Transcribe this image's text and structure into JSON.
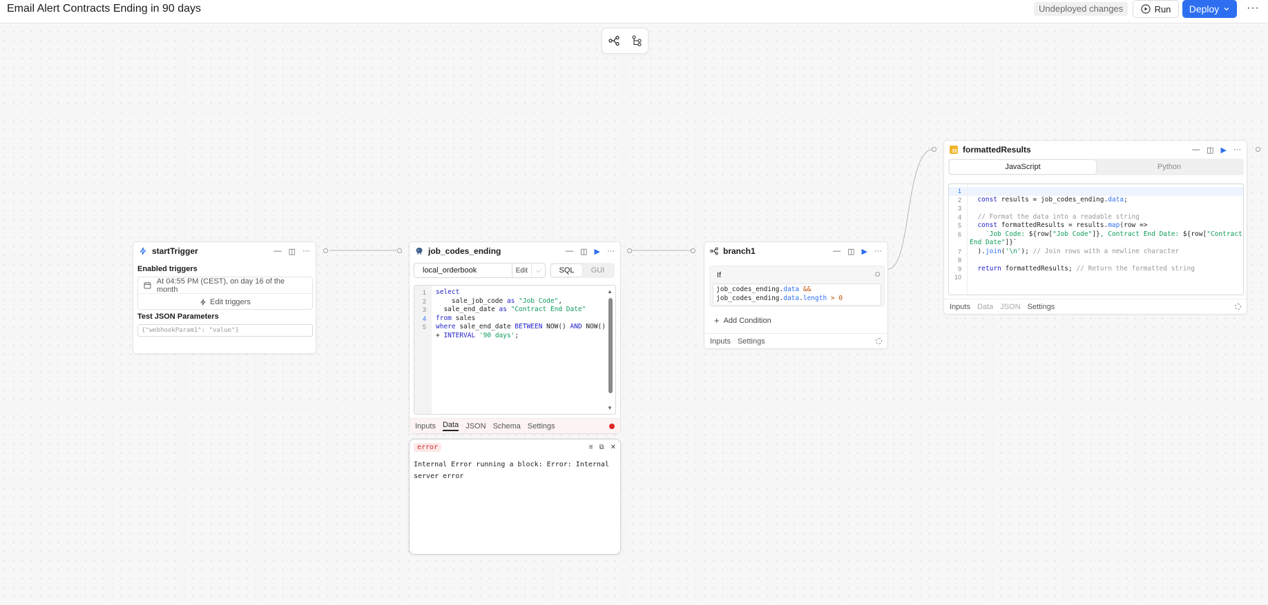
{
  "header": {
    "title": "Email Alert Contracts Ending in 90 days",
    "status_badge": "Undeployed changes",
    "run_label": "Run",
    "deploy_label": "Deploy",
    "more_label": "···"
  },
  "nodes": {
    "start_trigger": {
      "title": "startTrigger",
      "enabled_triggers_label": "Enabled triggers",
      "schedule_text": "At 04:55 PM (CEST), on day 16 of the month",
      "edit_triggers_label": "Edit triggers",
      "test_json_label": "Test JSON Parameters",
      "test_json_placeholder": "{\"webhookParam1\": \"value\"}"
    },
    "job_codes_ending": {
      "title": "job_codes_ending",
      "resource": "local_orderbook",
      "edit_label": "Edit",
      "mode_sql": "SQL",
      "mode_gui": "GUI",
      "line_numbers": [
        "1",
        "2",
        "3",
        "4",
        "5"
      ],
      "tabs": [
        "Inputs",
        "Data",
        "JSON",
        "Schema",
        "Settings"
      ],
      "active_tab": "Data"
    },
    "error_panel": {
      "badge": "error",
      "message": "Internal Error running a block: Error: Internal server error"
    },
    "branch1": {
      "title": "branch1",
      "if_label": "If",
      "add_condition_label": "Add Condition",
      "tabs": [
        "Inputs",
        "Settings"
      ]
    },
    "formatted_results": {
      "title": "formattedResults",
      "lang_js": "JavaScript",
      "lang_python": "Python",
      "line_numbers": [
        "1",
        "2",
        "3",
        "4",
        "5",
        "6",
        "",
        "7",
        "8",
        "9",
        "10"
      ],
      "tabs": [
        "Inputs",
        "Data",
        "JSON",
        "Settings"
      ]
    }
  },
  "code": {
    "sql": [
      [
        {
          "t": "select",
          "c": "kw"
        }
      ],
      [
        {
          "t": "    sale_job_code ",
          "c": ""
        },
        {
          "t": "as",
          "c": "kw"
        },
        {
          "t": " \"Job Code\"",
          "c": "str"
        },
        {
          "t": ",",
          "c": ""
        }
      ],
      [
        {
          "t": "  sale_end_date ",
          "c": ""
        },
        {
          "t": "as",
          "c": "kw"
        },
        {
          "t": " \"Contract End Date\"",
          "c": "str"
        }
      ],
      [
        {
          "t": "from",
          "c": "kw"
        },
        {
          "t": " sales",
          "c": ""
        }
      ],
      [
        {
          "t": "where",
          "c": "kw"
        },
        {
          "t": " sale_end_date ",
          "c": ""
        },
        {
          "t": "BETWEEN",
          "c": "kw"
        },
        {
          "t": " NOW() ",
          "c": ""
        },
        {
          "t": "AND",
          "c": "kw"
        },
        {
          "t": " NOW()",
          "c": ""
        }
      ],
      [
        {
          "t": "+ ",
          "c": ""
        },
        {
          "t": "INTERVAL",
          "c": "kw"
        },
        {
          "t": " '90 days'",
          "c": "str"
        },
        {
          "t": ";",
          "c": ""
        }
      ]
    ],
    "condition": [
      [
        {
          "t": "job_codes_ending.",
          "c": ""
        },
        {
          "t": "data",
          "c": "prop"
        },
        {
          "t": " &&",
          "c": "num"
        }
      ],
      [
        {
          "t": "job_codes_ending.",
          "c": ""
        },
        {
          "t": "data",
          "c": "prop"
        },
        {
          "t": ".",
          "c": ""
        },
        {
          "t": "length",
          "c": "prop"
        },
        {
          "t": " > 0",
          "c": "num"
        }
      ]
    ],
    "js": [
      [
        {
          "t": "",
          "c": ""
        }
      ],
      [
        {
          "t": "  const",
          "c": "kw"
        },
        {
          "t": " results = job_codes_ending.",
          "c": ""
        },
        {
          "t": "data",
          "c": "prop"
        },
        {
          "t": ";",
          "c": ""
        }
      ],
      [
        {
          "t": "",
          "c": ""
        }
      ],
      [
        {
          "t": "  // Format the data into a readable string",
          "c": "cm"
        }
      ],
      [
        {
          "t": "  const",
          "c": "kw"
        },
        {
          "t": " formattedResults = results.",
          "c": ""
        },
        {
          "t": "map",
          "c": "prop"
        },
        {
          "t": "(row =>",
          "c": ""
        }
      ],
      [
        {
          "t": "    `Job Code: ",
          "c": "str"
        },
        {
          "t": "${row[",
          "c": ""
        },
        {
          "t": "\"Job Code\"",
          "c": "str"
        },
        {
          "t": "]}",
          "c": ""
        },
        {
          "t": ", Contract End Date: ",
          "c": "str"
        },
        {
          "t": "${row[",
          "c": ""
        },
        {
          "t": "\"Contract",
          "c": "str"
        }
      ],
      [
        {
          "t": "End Date\"",
          "c": "str"
        },
        {
          "t": "]}`",
          "c": ""
        }
      ],
      [
        {
          "t": "  ).",
          "c": ""
        },
        {
          "t": "join",
          "c": "prop"
        },
        {
          "t": "(",
          "c": ""
        },
        {
          "t": "'\\n'",
          "c": "str"
        },
        {
          "t": "); ",
          "c": ""
        },
        {
          "t": "// Join rows with a newline character",
          "c": "cm"
        }
      ],
      [
        {
          "t": "",
          "c": ""
        }
      ],
      [
        {
          "t": "  return",
          "c": "kw"
        },
        {
          "t": " formattedResults; ",
          "c": ""
        },
        {
          "t": "// Return the formatted string",
          "c": "cm"
        }
      ],
      [
        {
          "t": "",
          "c": ""
        }
      ]
    ]
  },
  "colors": {
    "accent": "#2d6ff0",
    "error": "#e02424",
    "keyword": "#2323c8",
    "string": "#0d9a5a"
  }
}
